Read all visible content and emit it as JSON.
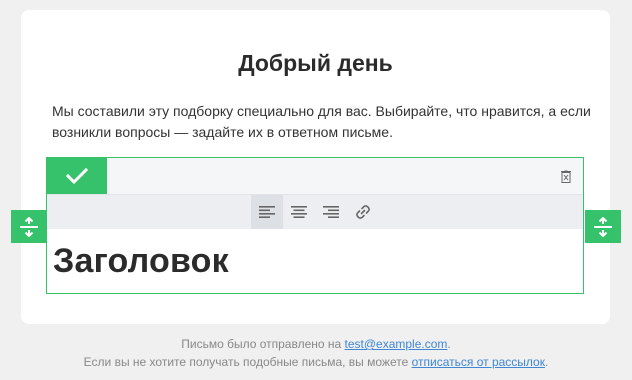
{
  "email": {
    "greeting": "Добрый день",
    "intro": "Мы составили эту подборку специально для вас. Выбирайте, что нравится, а если возникли вопросы — задайте их в ответном письме."
  },
  "editor": {
    "heading_text": "Заголовок",
    "toolbar": {
      "buttons": [
        "align-left-icon",
        "align-center-icon",
        "align-right-icon",
        "link-icon"
      ],
      "active": "align-left-icon"
    },
    "accent_color": "#36c26b"
  },
  "footer": {
    "line1_prefix": "Письмо было отправлено на ",
    "line1_email": "test@example.com",
    "line1_suffix": ".",
    "line2_prefix": "Если вы не хотите получать подобные письма, вы можете ",
    "line2_link": "отписаться от рассылок",
    "line2_suffix": "."
  },
  "colors": {
    "page_bg": "#f0f0f0",
    "card_bg": "#ffffff",
    "accent": "#36c26b",
    "link": "#3f86d4"
  }
}
